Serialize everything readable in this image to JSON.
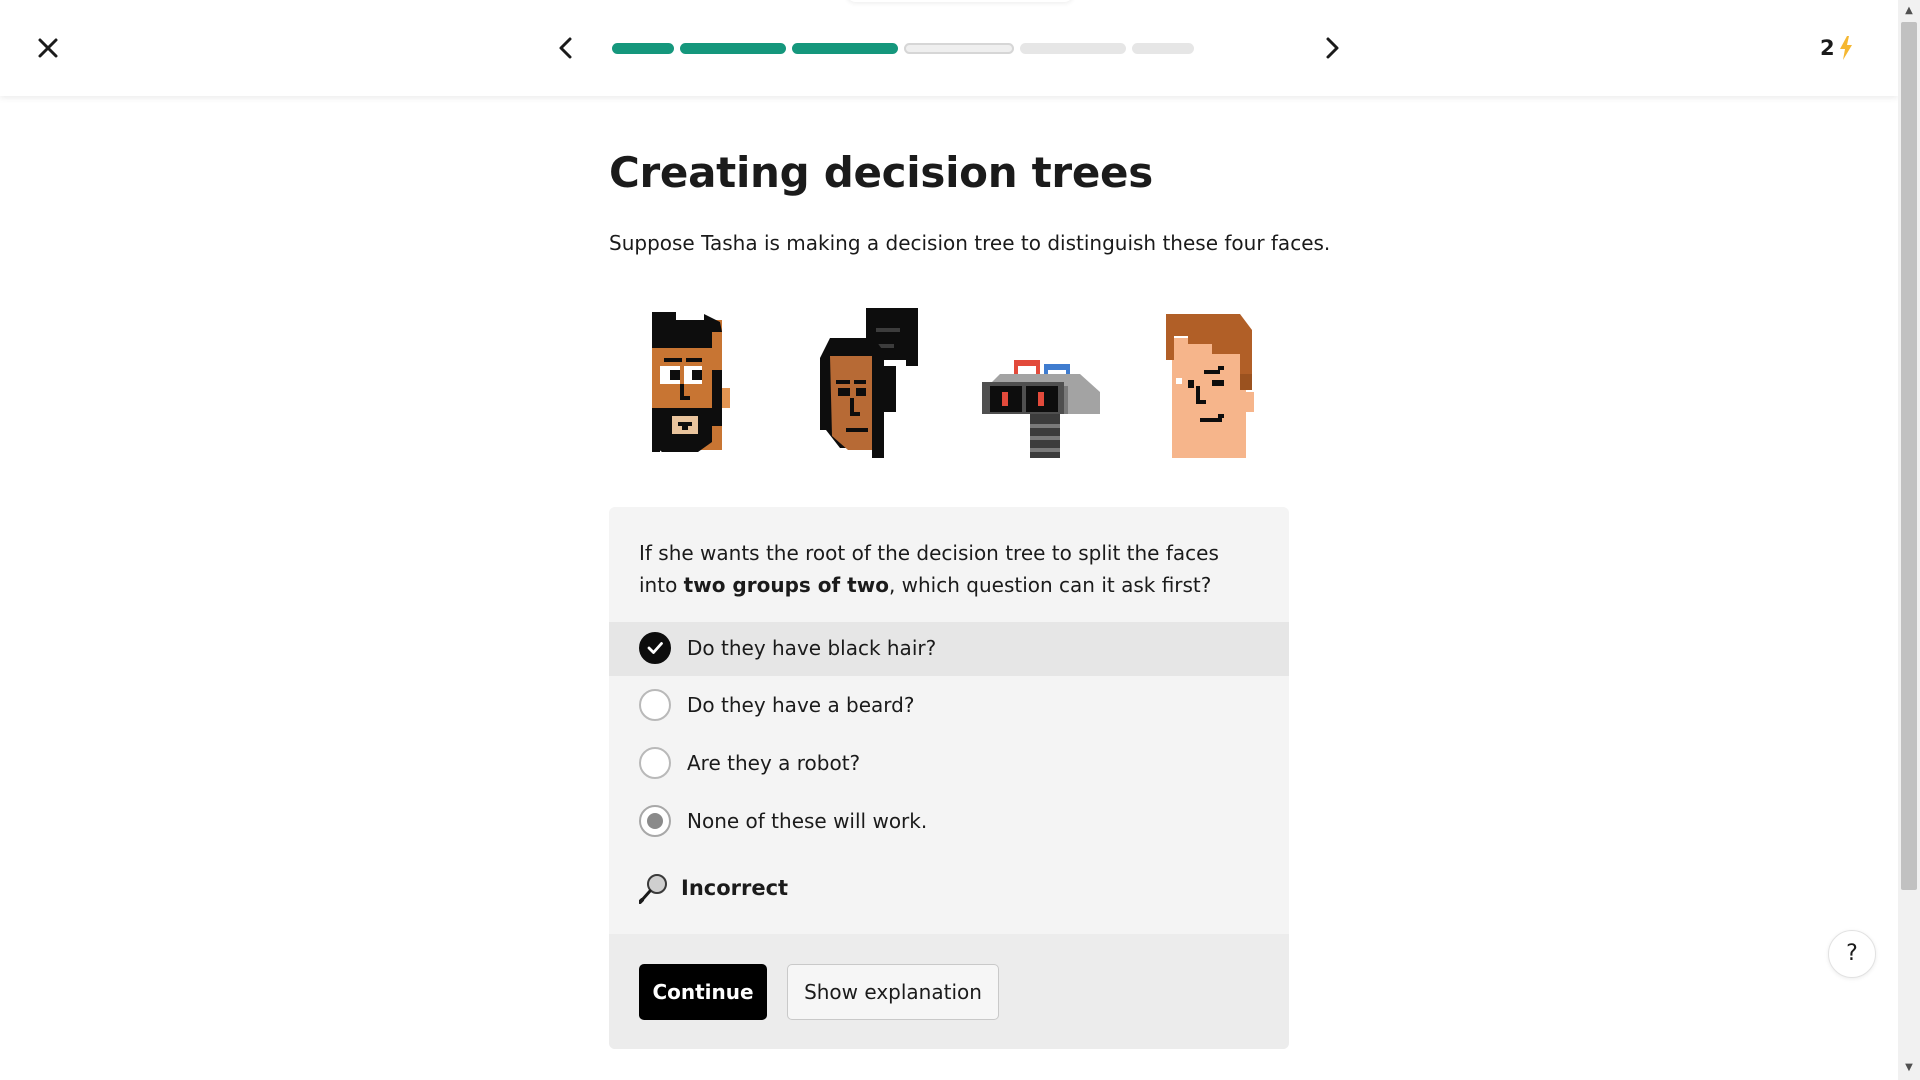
{
  "header": {
    "streak_count": "2",
    "progress": {
      "completed": 3,
      "current": 4,
      "total": 6
    },
    "colors": {
      "progress_done": "#15977c",
      "streak_bolt": "#f5b731"
    }
  },
  "lesson": {
    "title": "Creating decision trees",
    "intro": "Suppose Tasha is making a decision tree to distinguish these four faces.",
    "faces": [
      "face-bearded-man",
      "face-woman-black-hair",
      "face-robot",
      "face-brown-hair-man"
    ]
  },
  "quiz": {
    "question_parts": {
      "before": "If she wants the root of the decision tree to split the faces into ",
      "bold": "two groups of two",
      "after": ", which question can it ask first?"
    },
    "options": [
      {
        "label": "Do they have black hair?",
        "state": "correct"
      },
      {
        "label": "Do they have a beard?",
        "state": "unselected"
      },
      {
        "label": "Are they a robot?",
        "state": "unselected"
      },
      {
        "label": "None of these will work.",
        "state": "chosen"
      }
    ],
    "feedback": "Incorrect",
    "continue_label": "Continue",
    "explain_label": "Show explanation"
  },
  "help": {
    "label": "?"
  }
}
